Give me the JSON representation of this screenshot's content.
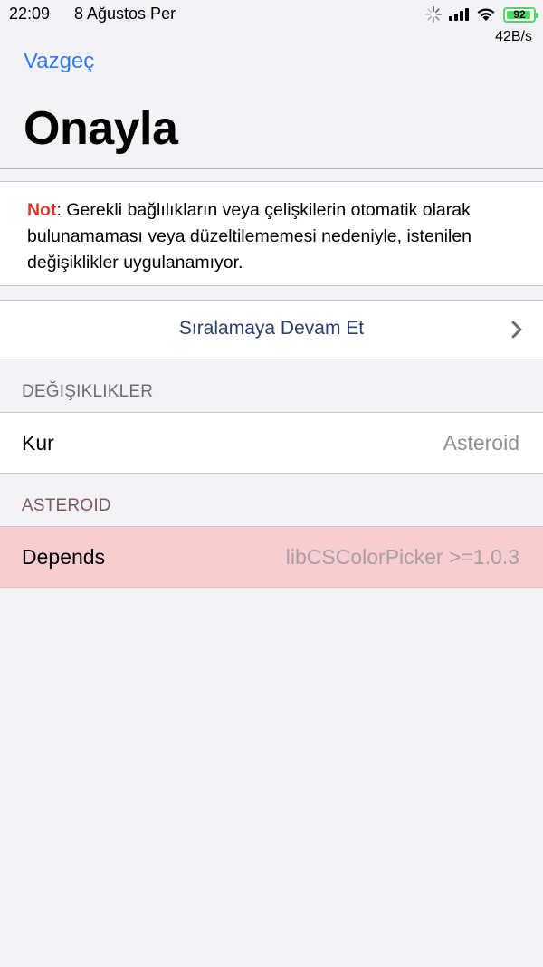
{
  "status_bar": {
    "time": "22:09",
    "date": "8 Ağustos Per",
    "battery_level": "92",
    "network_speed": "42B/s",
    "icons": [
      "activity-spinner-icon",
      "cellular-signal-icon",
      "wifi-icon",
      "battery-icon"
    ],
    "battery_color": "#4cd964"
  },
  "nav": {
    "cancel_label": "Vazgeç",
    "title": "Onayla"
  },
  "note": {
    "label": "Not",
    "message": ": Gerekli bağlılıkların veya çelişkilerin otomatik olarak bulunamaması veya düzeltilememesi nedeniyle, istenilen değişiklikler uygulanamıyor."
  },
  "queue": {
    "continue_label": "Sıralamaya Devam Et"
  },
  "sections": [
    {
      "header": "DEĞIŞIKLIKLER",
      "rows": [
        {
          "label": "Kur",
          "value": "Asteroid"
        }
      ]
    },
    {
      "header": "ASTEROID",
      "rows": [
        {
          "label": "Depends",
          "value": "libCSColorPicker >=1.0.3"
        }
      ]
    }
  ],
  "colors": {
    "accent": "#3478f6",
    "error": "#e0312b",
    "error_row_background": "#f7cdcf"
  }
}
